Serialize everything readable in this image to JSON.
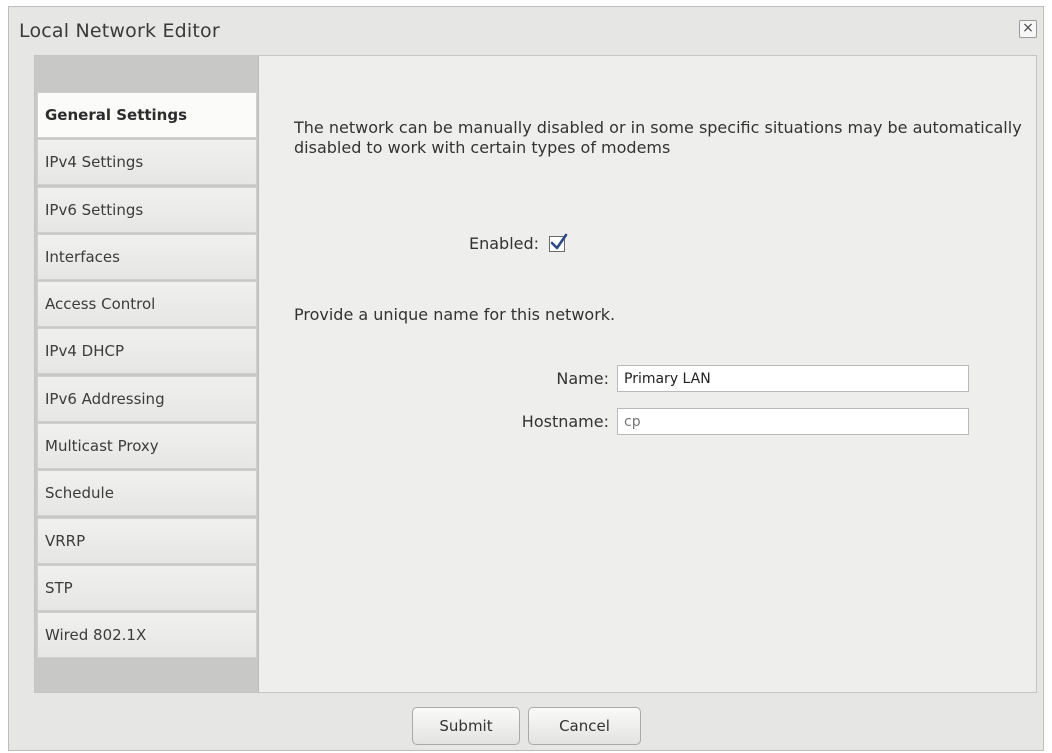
{
  "window": {
    "title": "Local Network Editor",
    "close_glyph": "×"
  },
  "sidebar": {
    "items": [
      {
        "label": "General Settings",
        "active": true
      },
      {
        "label": "IPv4 Settings"
      },
      {
        "label": "IPv6 Settings"
      },
      {
        "label": "Interfaces"
      },
      {
        "label": "Access Control"
      },
      {
        "label": "IPv4 DHCP"
      },
      {
        "label": "IPv6 Addressing"
      },
      {
        "label": "Multicast Proxy"
      },
      {
        "label": "Schedule"
      },
      {
        "label": "VRRP"
      },
      {
        "label": "STP"
      },
      {
        "label": "Wired 802.1X"
      }
    ]
  },
  "main": {
    "description": "The network can be manually disabled or in some specific situations may be automatically disabled to work with certain types of modems",
    "enabled": {
      "label": "Enabled:",
      "checked": true
    },
    "name_prompt": "Provide a unique name for this network.",
    "name": {
      "label": "Name:",
      "value": "Primary LAN"
    },
    "hostname": {
      "label": "Hostname:",
      "placeholder": "cp"
    }
  },
  "footer": {
    "submit_label": "Submit",
    "cancel_label": "Cancel"
  }
}
